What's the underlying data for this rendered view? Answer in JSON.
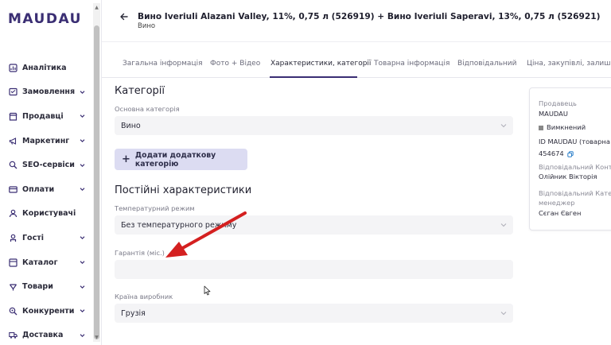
{
  "brand": {
    "logo": "MAUDAU"
  },
  "sidebar": {
    "items": [
      {
        "label": "Аналітика",
        "icon": "chart-icon",
        "chevron": false
      },
      {
        "label": "Замовлення",
        "icon": "orders-icon",
        "chevron": true
      },
      {
        "label": "Продавці",
        "icon": "store-icon",
        "chevron": true
      },
      {
        "label": "Маркетинг",
        "icon": "megaphone-icon",
        "chevron": true
      },
      {
        "label": "SEO-сервіси",
        "icon": "seo-icon",
        "chevron": true
      },
      {
        "label": "Оплати",
        "icon": "card-icon",
        "chevron": true
      },
      {
        "label": "Користувачі",
        "icon": "user-icon",
        "chevron": false
      },
      {
        "label": "Гості",
        "icon": "guest-icon",
        "chevron": true
      },
      {
        "label": "Каталог",
        "icon": "catalog-icon",
        "chevron": true
      },
      {
        "label": "Товари",
        "icon": "bottle-icon",
        "chevron": true
      },
      {
        "label": "Конкуренти",
        "icon": "search-competitor-icon",
        "chevron": true
      },
      {
        "label": "Доставка",
        "icon": "truck-icon",
        "chevron": true
      }
    ]
  },
  "header": {
    "title": "Вино Iveriuli Alazani Valley, 11%, 0,75 л (526919) + Вино Iveriuli Saperavi, 13%, 0,75 л (526921)",
    "subtitle": "Вино"
  },
  "tabs": [
    {
      "label": "Загальна інформація",
      "active": false
    },
    {
      "label": "Фото + Відео",
      "active": false
    },
    {
      "label": "Характеристики, категорії",
      "active": true
    },
    {
      "label": "Товарна інформація",
      "active": false
    },
    {
      "label": "Відповідальний",
      "active": false
    },
    {
      "label": "Ціна, закупівлі, залишки",
      "active": false
    }
  ],
  "categories": {
    "heading": "Категорії",
    "main_label": "Основна категорія",
    "main_value": "Вино",
    "add_button": "Додати додаткову категорію"
  },
  "characteristics": {
    "heading": "Постійні характеристики",
    "temperature_label": "Температурний режим",
    "temperature_value": "Без температурного режиму",
    "warranty_label": "Гарантія (міс.)",
    "warranty_value": "",
    "country_label": "Країна виробник",
    "country_value": "Грузія"
  },
  "side_card": {
    "seller_label": "Продавець",
    "seller_value": "MAUDAU",
    "status": "Вимкнений",
    "id_label": "ID MAUDAU (товарна",
    "id_value": "454674",
    "responsible_content_label": "Відповідальний Конте",
    "responsible_content_value": "Олійник Вікторія",
    "responsible_category_label": "Відповідальний Катег",
    "responsible_category_label2": "менеджер",
    "responsible_category_value": "Сєган Євген"
  },
  "colors": {
    "brand": "#3a2e73",
    "annotation_arrow": "#d42020",
    "button_bg": "#dcdcf2"
  }
}
